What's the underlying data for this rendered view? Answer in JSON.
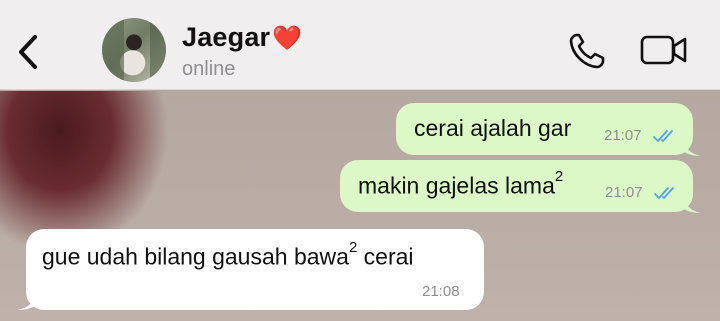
{
  "header": {
    "contact_name": "Jaegar",
    "heart": "❤️",
    "status": "online"
  },
  "messages": [
    {
      "direction": "outgoing",
      "text": "cerai ajalah gar",
      "time": "21:07",
      "read": true
    },
    {
      "direction": "outgoing",
      "text": "makin gajelas lama",
      "superscript": "2",
      "time": "21:07",
      "read": true
    },
    {
      "direction": "incoming",
      "text_before": "gue udah bilang gausah bawa",
      "superscript": "2",
      "text_after": " cerai",
      "time": "21:08"
    }
  ],
  "colors": {
    "outgoing_bubble": "#dcf8c6",
    "incoming_bubble": "#ffffff",
    "read_ticks": "#4fa3e8",
    "header_bg": "#f0eeee"
  },
  "icons": [
    "chevron-left-icon",
    "phone-icon",
    "video-camera-icon",
    "double-check-icon"
  ]
}
